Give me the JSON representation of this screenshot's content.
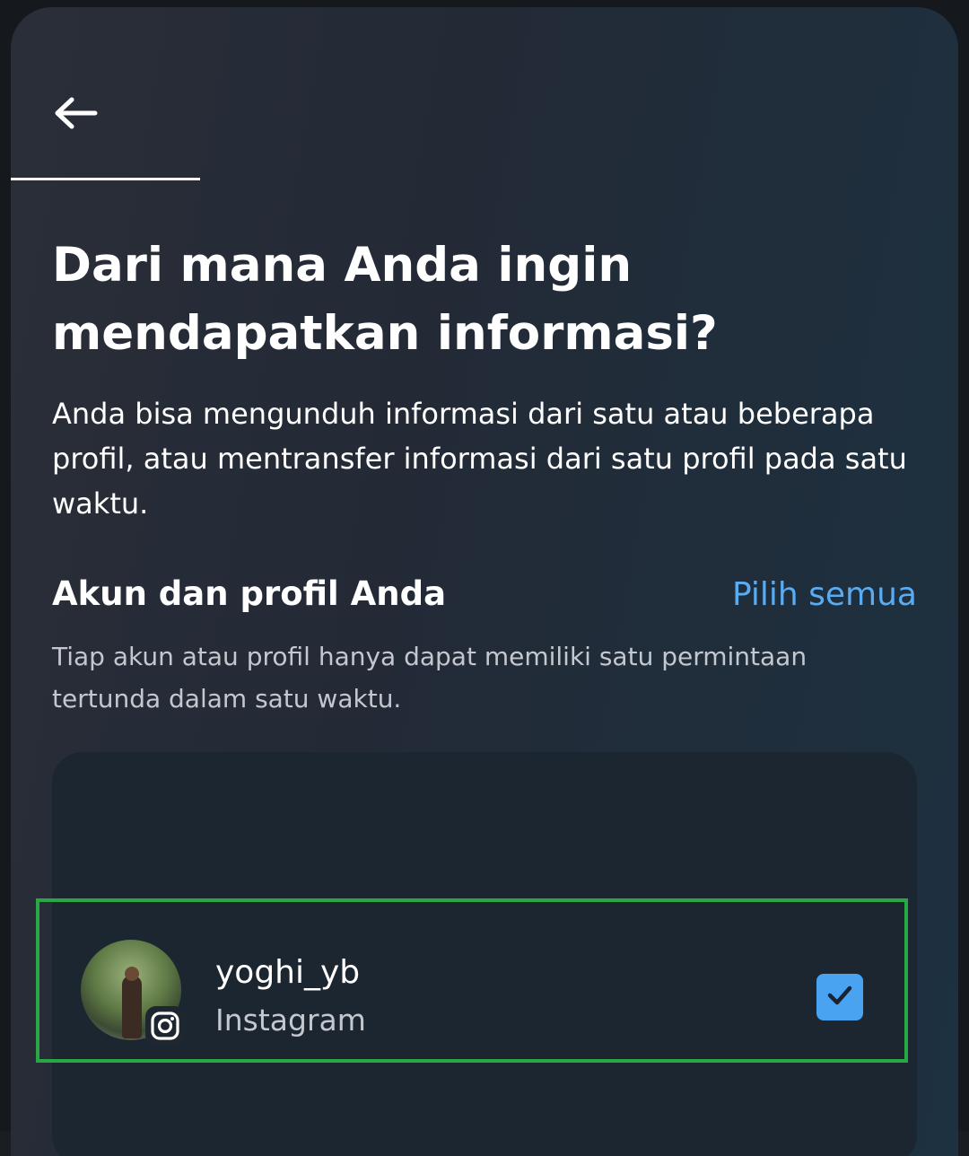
{
  "header": {
    "back_icon": "arrow-left-icon",
    "progress_fraction": 0.2
  },
  "main": {
    "title": "Dari mana Anda ingin mendapatkan informasi?",
    "description": "Anda bisa mengunduh informasi dari satu atau beberapa profil, atau mentransfer informasi dari satu profil pada satu waktu.",
    "section_title": "Akun dan profil Anda",
    "select_all_label": "Pilih semua",
    "section_note": "Tiap akun atau profil hanya dapat memiliki satu permintaan tertunda dalam satu waktu."
  },
  "accounts": [
    {
      "username": "yoghi_yb",
      "platform": "Instagram",
      "platform_icon": "instagram-icon",
      "checked": true
    }
  ],
  "colors": {
    "accent": "#5aacf2",
    "checkbox": "#4aa3f0",
    "highlight_border": "#28a745"
  }
}
